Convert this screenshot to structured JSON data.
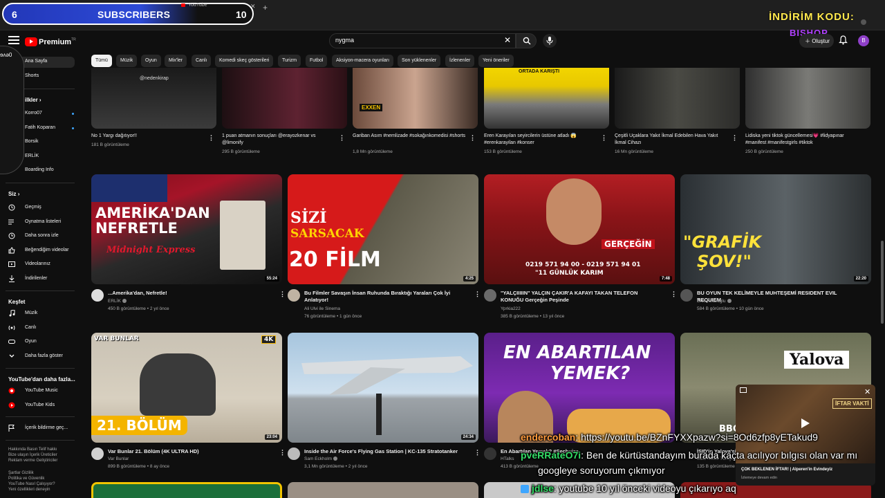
{
  "overlay": {
    "subscribers": {
      "current": "6",
      "label": "SUBSCRIBERS",
      "goal": "10"
    },
    "promo_line1": "İNDİRİM KODU:",
    "promo_line2": "BISHOP",
    "sidebar_fragment": "ɘʌə0"
  },
  "browser": {
    "tab_title": "YouTube"
  },
  "header": {
    "logo_text": "Premium",
    "logo_sup": "TR",
    "search_value": "nygma",
    "create_label": "Oluştur",
    "avatar_letter": "B"
  },
  "sidebar": {
    "top_items": [
      {
        "label": "Ana Sayfa"
      },
      {
        "label": "Shorts"
      }
    ],
    "subs_head": "ilkler",
    "subs": [
      {
        "label": "Korro07"
      },
      {
        "label": "Fatih Koparan"
      },
      {
        "label": "Borsik"
      },
      {
        "label": "ERLİK"
      },
      {
        "label": "Boarding Info"
      }
    ],
    "you_head": "Siz",
    "you_items": [
      {
        "label": "Geçmiş"
      },
      {
        "label": "Oynatma listeleri"
      },
      {
        "label": "Daha sonra izle"
      },
      {
        "label": "Beğendiğim videolar"
      },
      {
        "label": "Videolarınız"
      },
      {
        "label": "İndirilenler"
      }
    ],
    "explore_head": "Keşfet",
    "explore_items": [
      {
        "label": "Müzik"
      },
      {
        "label": "Canlı"
      },
      {
        "label": "Oyun"
      },
      {
        "label": "Daha fazla göster"
      }
    ],
    "more_head": "YouTube'dan daha fazla...",
    "more_items": [
      {
        "label": "YouTube Music"
      },
      {
        "label": "YouTube Kids"
      }
    ],
    "report_label": "İçerik bildirme geç...",
    "footer1": "Hakkında  Basın  Telif hakkı",
    "footer2": "Bize ulaşın  İçerik Üreticiler",
    "footer3": "Reklam verme  Geliştiriciler",
    "footer4": "Şartlar  Gizlilik",
    "footer5": "Politika ve Güvenlik",
    "footer6": "YouTube Nasıl Çalışıyor?",
    "footer7": "Yeni özellikleri deneyin"
  },
  "chips": [
    "Tümü",
    "Müzik",
    "Oyun",
    "Mix'ler",
    "Canlı",
    "Komedi skeç gösterileri",
    "Turizm",
    "Futbol",
    "Aksiyon-macera oyunları",
    "Son yüklenenler",
    "İzlenenler",
    "Yeni öneriler"
  ],
  "top_row": [
    {
      "title": "No 1 Yargı dağıtıyor!!",
      "meta": "181 B görüntüleme",
      "thumb_text": "@nedenkirap"
    },
    {
      "title": "1 puan atmanın sonuçları @erayozkenar vs @limonify",
      "meta": "295 B görüntüleme",
      "thumb_text": ""
    },
    {
      "title": "Gariban Asım #nemlizade #sokağınkomedisi #shorts",
      "meta": "1,8 Mn görüntüleme",
      "thumb_text": "EXXEN"
    },
    {
      "title": "Eren Karayılan seyircilerin üstüne atladı 😱 #erenkarayilan #konser",
      "meta": "153 B görüntüleme",
      "thumb_text": "ORTADA KARIŞTI"
    },
    {
      "title": "Çeşitli Uçaklara Yakıt İkmal Edebilen Hava Yakıt İkmal Cihazı",
      "meta": "16 Mn görüntüleme",
      "thumb_text": ""
    },
    {
      "title": "Lidiska yeni tiktok güncellemesi💗 #lidyapınar #manifest #manifestgirls #tiktok",
      "meta": "250 B görüntüleme",
      "thumb_text": ""
    }
  ],
  "videos": [
    {
      "title": "...Amerika'dan, Nefretle!",
      "channel": "ERLİK",
      "meta": "450 B görüntüleme • 2 yıl önce",
      "duration": "55:24",
      "thumb_l1": "AMERİKA'DAN",
      "thumb_l2": "NEFRETLE",
      "thumb_l3": "Midnight Express"
    },
    {
      "title": "Bu Filmler Savaşın İnsan Ruhunda Bıraktığı Yaraları Çok İyi Anlatıyor!",
      "channel": "Ali Ulvi ile Sinema",
      "meta": "76 görüntüleme • 1 gün önce",
      "duration": "4:25",
      "thumb_l1": "SİZİ",
      "thumb_l2": "SARSACAK",
      "thumb_l3": "20 FİLM"
    },
    {
      "title": "\"YALÇIIIIIN\" YALÇIN ÇAKIR'A KAFAYI TAKAN TELEFON KONUĞU Gerçeğin Peşinde",
      "channel": "Yprkia222",
      "meta": "385 B görüntüleme • 13 yıl önce",
      "duration": "7:48",
      "thumb_l1": "GERÇEĞİN",
      "thumb_l2": "0219 571 94 00 - 0219 571 94 01",
      "thumb_l3": "\"11 GÜNLÜK KARIM"
    },
    {
      "title": "BU OYUN TEK KELİMEYLE MUHTEŞEMİ RESIDENT EVIL REQUIEM",
      "channel": "Enis Kirazoglu",
      "meta": "584 B görüntüleme • 10 gün önce",
      "duration": "22:20",
      "thumb_l1": "\"GRAFİK",
      "thumb_l2": "ŞOV!\"",
      "thumb_l3": ""
    },
    {
      "title": "Var Bunlar 21. Bölüm (4K ULTRA HD)",
      "channel": "Var Bunlar",
      "meta": "899 B görüntüleme • 8 ay önce",
      "duration": "23:04",
      "thumb_l1": "VAR BUNLAR",
      "thumb_l2": "21. BÖLÜM",
      "thumb_l3": "4K"
    },
    {
      "title": "Inside the Air Force's Flying Gas Station | KC-135 Stratotanker",
      "channel": "Sam Eckholm",
      "meta": "3,1 Mn görüntüleme • 2 yıl önce",
      "duration": "24:34",
      "thumb_l1": "",
      "thumb_l2": "",
      "thumb_l3": ""
    },
    {
      "title": "En Abartılan Yemek? #Sechuiza",
      "channel": "HTalks",
      "meta": "413 B görüntüleme",
      "duration": "",
      "thumb_l1": "EN ABARTILAN",
      "thumb_l2": "YEMEK?",
      "thumb_l3": ""
    },
    {
      "title": "İSID'in Yalova'si",
      "channel": "BBC News Türkçe",
      "meta": "135 B görüntüleme",
      "duration": "",
      "thumb_l1": "Yalova",
      "thumb_l2": "BBC",
      "thumb_l3": ""
    }
  ],
  "miniplayer": {
    "title": "ÇOK BEKLENEN İFTAR! | Alperen'in Evindeyiz",
    "subtitle": "İzlemeye devam edin",
    "badge": "İFTAR VAKTİ"
  },
  "chat": [
    {
      "user": "endercoban",
      "message": ": https://youtu.be/BZnFYXXpazw?si=8Od6zfp8yETakud9",
      "color": "#ff9a3c"
    },
    {
      "user": "pveRRateO7i",
      "message": ": Ben de kürtüstandayım burada kaçta acılıyor bılgısı olan var mı",
      "color": "#33dd66"
    },
    {
      "user": "",
      "message": "googleye soruyorum çıkmıyor",
      "color": "#ffffff"
    },
    {
      "user": "jdlse",
      "message": ": youtube 10 yıl önceki videoyu çıkarıyo aq",
      "color": "#33dd66"
    }
  ],
  "colors": {
    "accent": "#ff0000",
    "background": "#0f0f0f",
    "chip": "#272727",
    "subs_bar": "#2d4ad6"
  }
}
